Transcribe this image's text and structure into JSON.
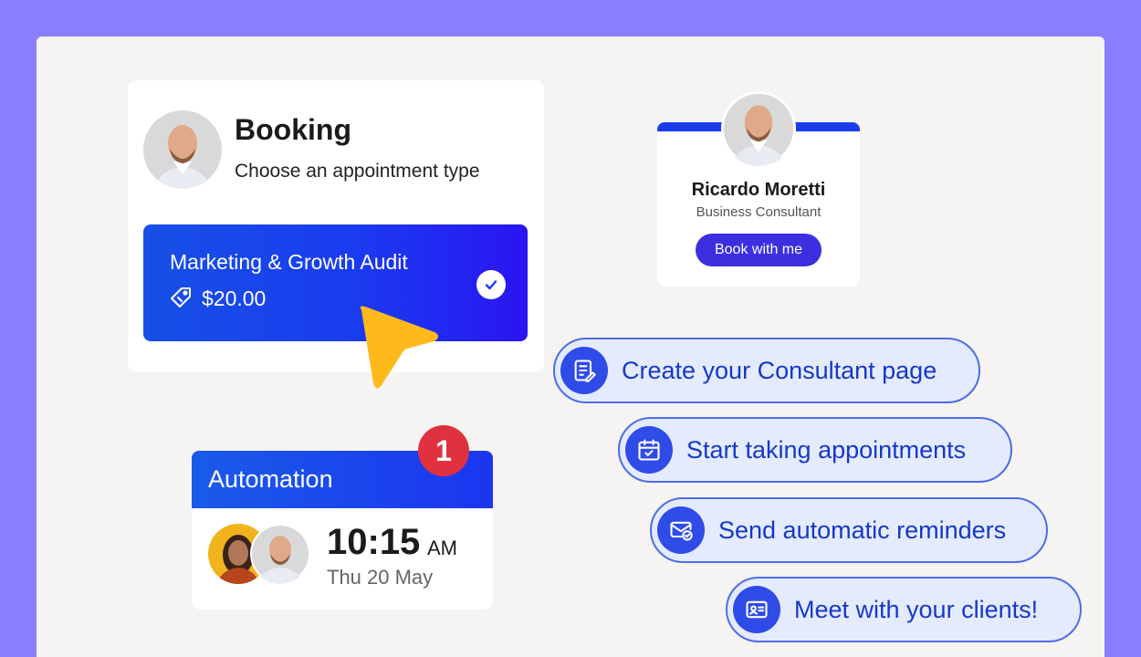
{
  "booking": {
    "title": "Booking",
    "subtitle": "Choose an appointment type",
    "service": {
      "name": "Marketing & Growth Audit",
      "price": "$20.00"
    }
  },
  "consultant": {
    "name": "Ricardo Moretti",
    "role": "Business Consultant",
    "book_label": "Book with me"
  },
  "automation": {
    "title": "Automation",
    "badge": "1",
    "time": "10:15",
    "ampm": "AM",
    "date": "Thu 20 May"
  },
  "steps": [
    {
      "label": "Create your Consultant page",
      "icon": "page-edit-icon"
    },
    {
      "label": "Start taking appointments",
      "icon": "calendar-check-icon"
    },
    {
      "label": "Send automatic reminders",
      "icon": "mail-check-icon"
    },
    {
      "label": "Meet with your clients!",
      "icon": "id-card-icon"
    }
  ],
  "colors": {
    "background": "#8a7dff",
    "accent": "#1a3cf0",
    "button": "#3b2fe0",
    "badge": "#e0313f",
    "pointer": "#ffb91a",
    "pill_bg": "#e5ebff",
    "pill_text": "#1538c8"
  }
}
